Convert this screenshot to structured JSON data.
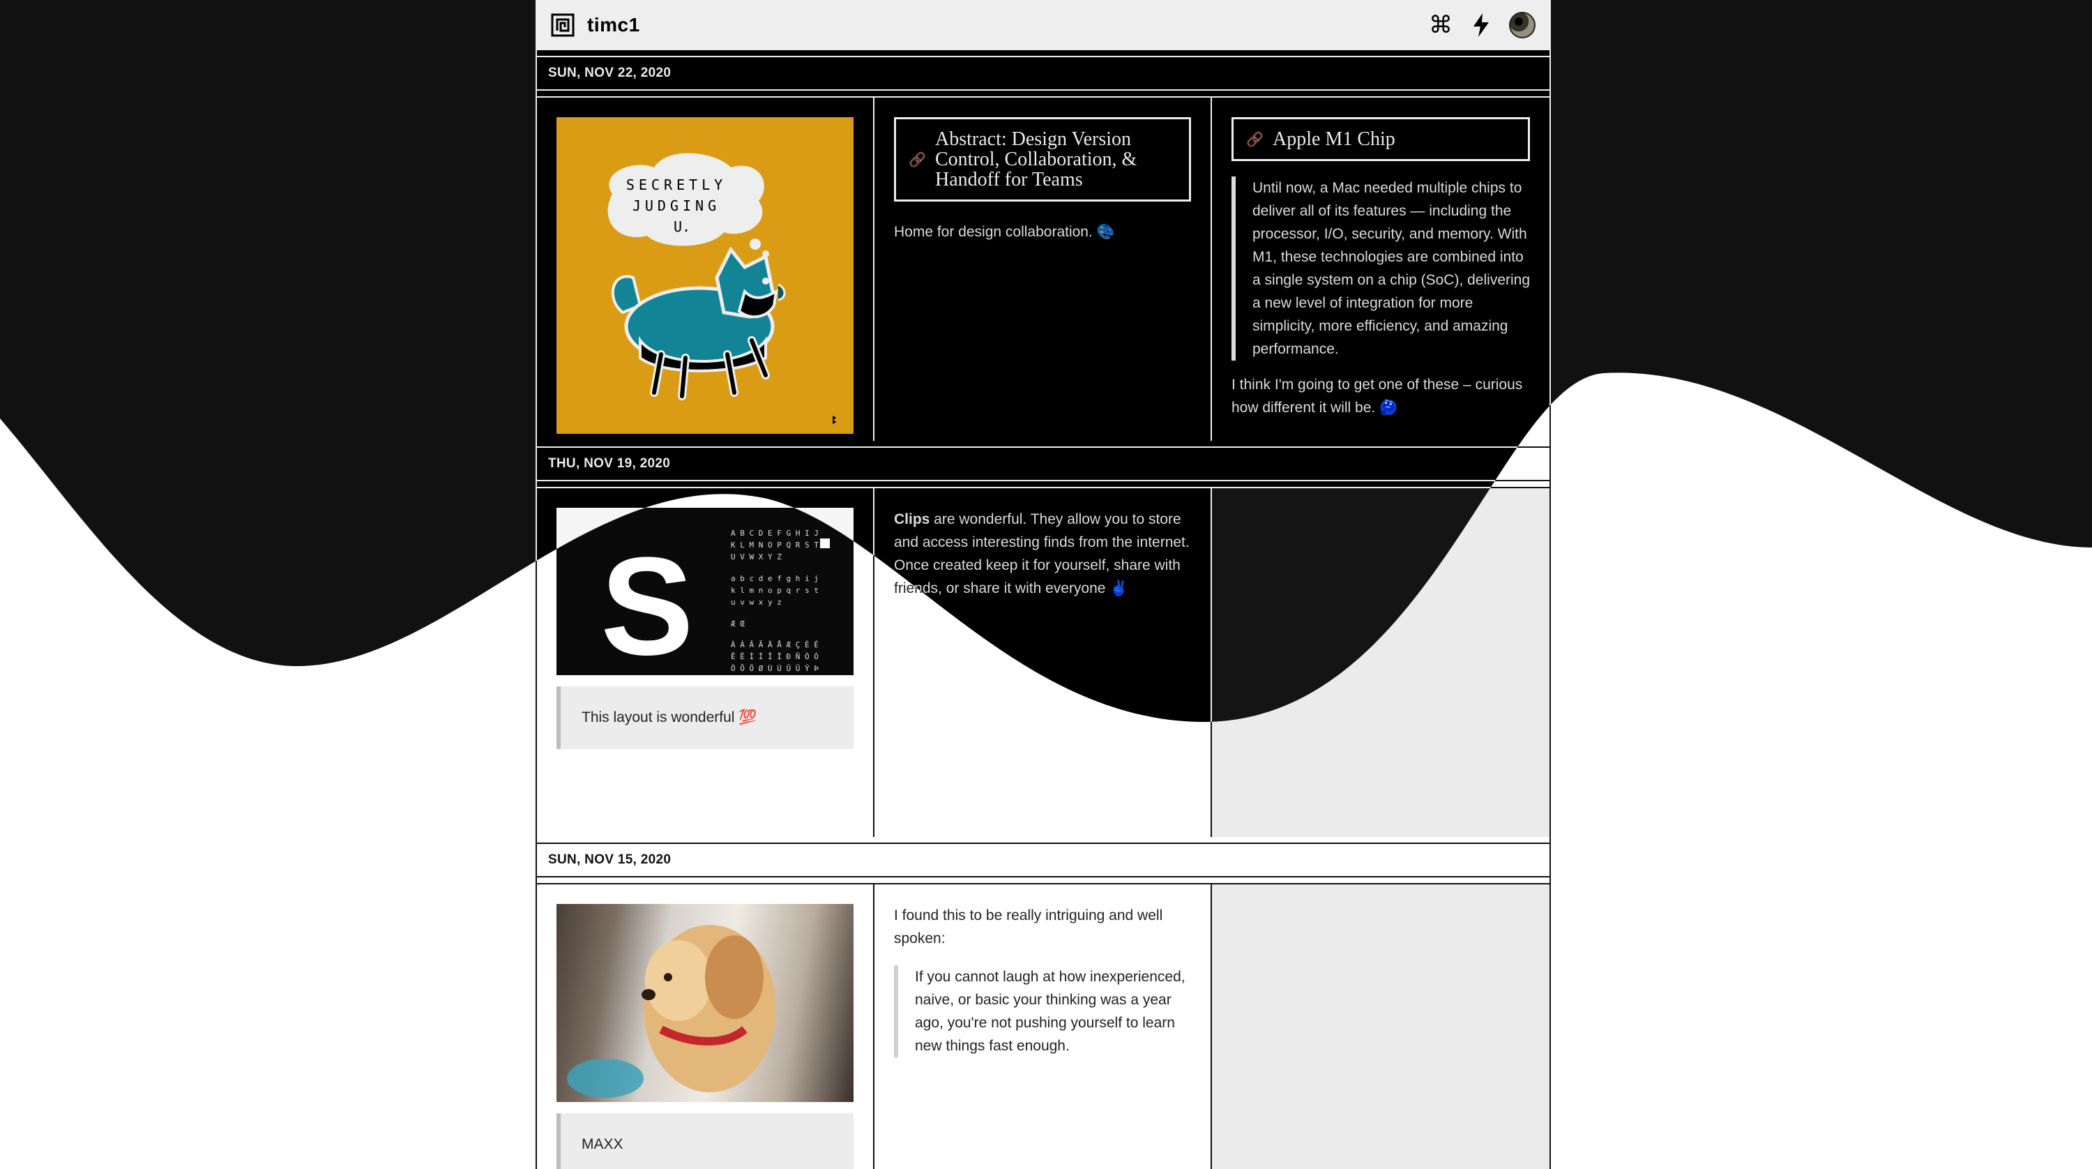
{
  "app": {
    "brand": "timc1"
  },
  "icons": {
    "command": "command-icon",
    "bolt": "lightning-icon",
    "avatar": "user-avatar"
  },
  "days": [
    {
      "date": "SUN, NOV 22, 2020",
      "image_text": "SECRETLY JUDGING U.",
      "link1": {
        "title": "Abstract: Design Version Control, Collaboration, & Handoff for Teams",
        "desc": "Home for design collaboration. 🎨"
      },
      "link2": {
        "title": "Apple M1 Chip",
        "quote": "Until now, a Mac needed multiple chips to deliver all of its features — including the processor, I/O, security, and memory. With M1, these technologies are combined into a single system on a chip (SoC), delivering a new level of integration for more simplicity, more efficiency, and amazing performance.",
        "note": "I think I'm going to get one of these – curious how different it will be. 🤔"
      }
    },
    {
      "date": "THU, NOV 19, 2020",
      "image_letter": "S",
      "caption": "This layout is wonderful 💯",
      "clips_bold": "Clips",
      "clips_text": " are wonderful. They allow you to store and access interesting finds from the internet. Once created keep it for yourself, share with friends, or share it with everyone ✌️"
    },
    {
      "date": "SUN, NOV 15, 2020",
      "caption": "MAXX",
      "intro": "I found this to be really intriguing and well spoken:",
      "quote": "If you cannot laugh at how inexperienced, naive, or basic your thinking was a year ago, you're not pushing yourself to learn new things fast enough."
    }
  ],
  "colors": {
    "accent_blue": "#2563eb",
    "ink": "#111111",
    "empty_cell": "#ebebeb"
  }
}
